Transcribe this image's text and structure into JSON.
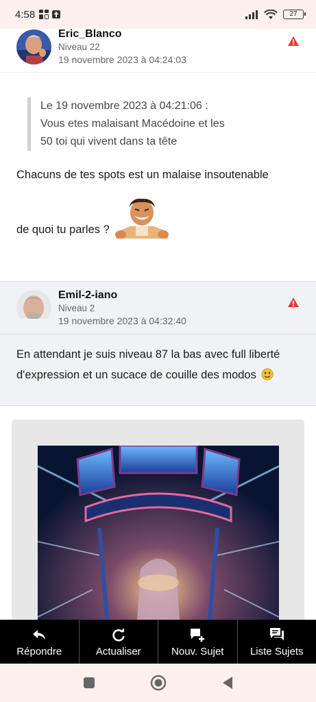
{
  "status_bar": {
    "time": "4:58",
    "battery": "27"
  },
  "post1": {
    "author": "Eric_Blanco",
    "level": "Niveau 22",
    "date": "19 novembre 2023 à 04:24:03",
    "quote_header": "Le 19 novembre 2023 à 04:21:06 :",
    "quote_line1": "Vous etes malaisant Macédoine et les",
    "quote_line2": "50 toi qui vivent dans ta tête",
    "message1": "Chacuns de tes spots est un malaise insoutenable",
    "message2": "de quoi tu parles ?"
  },
  "post2": {
    "author": "Emil-2-iano",
    "level": "Niveau 2",
    "date": "19 novembre 2023 à 04:32:40",
    "message": "En attendant je suis niveau 87 la bas avec full liberté d'expression et un sucace de couille des modos"
  },
  "bottom_bar": {
    "reply": "Répondre",
    "refresh": "Actualiser",
    "new_topic": "Nouv. Sujet",
    "topic_list": "Liste Sujets"
  },
  "colors": {
    "alert": "#e53935",
    "bottom_bar_bg": "#000000",
    "post2_bg": "#f0f2f5",
    "status_bg": "#fdf0ee"
  }
}
